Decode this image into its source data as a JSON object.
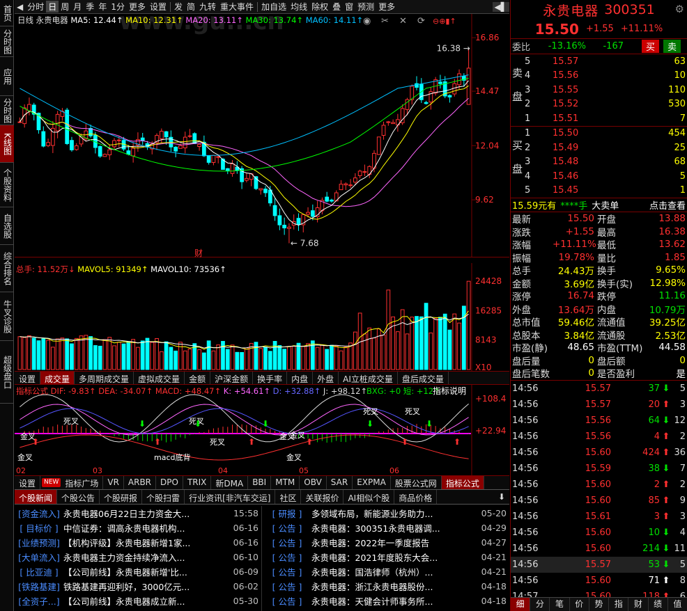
{
  "sidebar": [
    "首页",
    "分时图",
    "应用",
    "分时图",
    "K线图",
    "个股资料",
    "自选股",
    "综合排名",
    "牛叉诊股",
    "超级盘口"
  ],
  "toolbar": {
    "items": [
      "分时",
      "日",
      "周",
      "月",
      "季",
      "年",
      "1分",
      "更多",
      "设置",
      "发",
      "简",
      "九转",
      "重大事件",
      "加自选",
      "均线",
      "除权",
      "叠",
      "窗",
      "预测",
      "更多"
    ],
    "selected": "日"
  },
  "watermark": "www.gu...cn",
  "kline": {
    "period": "日线",
    "stock": "永贵电器",
    "ma": [
      {
        "label": "MA5: 12.44",
        "color": "#ffffff"
      },
      {
        "label": "MA10: 12.31",
        "color": "#ffff00"
      },
      {
        "label": "MA20: 13.11",
        "color": "#ff66ff"
      },
      {
        "label": "MA30: 13.74",
        "color": "#00ff00"
      },
      {
        "label": "MA60: 14.11",
        "color": "#00c0ff"
      }
    ],
    "price_ticks": [
      "16.86",
      "14.47",
      "12.04",
      "9.62"
    ],
    "high_label": "16.38",
    "low_label": "7.68",
    "event_label": "财"
  },
  "volume": {
    "title": "总手: 11.52万",
    "mavol5": "MAVOL5: 91349",
    "mavol10": "MAVOL10: 73536",
    "ticks": [
      "24428",
      "16285",
      "8143",
      "X10"
    ]
  },
  "volume_tabs": [
    "设置",
    "成交量",
    "多周期成交量",
    "虚拟成交量",
    "金额",
    "沪深金额",
    "换手率",
    "内盘",
    "外盘",
    "AI立桩成交量",
    "盘后成交量"
  ],
  "indicator": {
    "title": "指标公式",
    "dif": "DIF: -9.83",
    "dea": "DEA: -34.07",
    "macd": "MACD: +48.47",
    "k": "K: +54.61",
    "d": "D: +32.88",
    "j": "J: +98.12",
    "bxg": "BXG: +0",
    "short": "短: +12",
    "help": "指标说明",
    "ticks": [
      "+108.4",
      "+22.94"
    ],
    "months": [
      "02",
      "03",
      "04",
      "05",
      "06"
    ],
    "signals": [
      "金叉",
      "金叉",
      "macd底背",
      "死叉",
      "死叉",
      "死叉",
      "金叉",
      "死叉",
      "死叉",
      "金叉",
      "金叉"
    ]
  },
  "indicator_tabs": [
    "设置",
    "NEW",
    "指标广场",
    "VR",
    "ARBR",
    "DPO",
    "TRIX",
    "新DMA",
    "BBI",
    "MTM",
    "OBV",
    "SAR",
    "EXPMA",
    "股票公式网",
    "指标公式"
  ],
  "news_tabs": [
    "个股新闻",
    "个股公告",
    "个股研报",
    "个股扫雷",
    "行业资讯[非汽车交运]",
    "社区",
    "关联报价",
    "AI相似个股",
    "商品价格"
  ],
  "news_left": [
    {
      "tag": "[资金流入]",
      "text": "永贵电器06月22日主力资金大...",
      "date": "15:58"
    },
    {
      "tag": "[ 目标价 ]",
      "text": "中信证券：调高永贵电器机构...",
      "date": "06-16"
    },
    {
      "tag": "[业绩预测]",
      "text": "【机构评级】永贵电器新增1家...",
      "date": "06-16"
    },
    {
      "tag": "[大单流入]",
      "text": "永贵电器主力资金持续净流入...",
      "date": "06-10"
    },
    {
      "tag": "[ 比亚迪 ]",
      "text": "【公司前线】永贵电器新增'比...",
      "date": "06-09"
    },
    {
      "tag": "[铁路基建]",
      "text": "铁路基建再迎利好，3000亿元...",
      "date": "06-02"
    },
    {
      "tag": "[全资子...]",
      "text": "【公司前线】永贵电器成立新...",
      "date": "05-30"
    }
  ],
  "news_right": [
    {
      "tag": "[ 研报 ]",
      "text": "多领域布局，新能源业务助力...",
      "date": "05-20"
    },
    {
      "tag": "[ 公告 ]",
      "text": "永贵电器：300351永贵电器调...",
      "date": "04-29"
    },
    {
      "tag": "[ 公告 ]",
      "text": "永贵电器：2022年一季度报告",
      "date": "04-27"
    },
    {
      "tag": "[ 公告 ]",
      "text": "永贵电器：2021年度股东大会...",
      "date": "04-21"
    },
    {
      "tag": "[ 公告 ]",
      "text": "永贵电器：国浩律师（杭州）...",
      "date": "04-21"
    },
    {
      "tag": "[ 公告 ]",
      "text": "永贵电器：浙江永贵电器股份...",
      "date": "04-18"
    },
    {
      "tag": "[ 公告 ]",
      "text": "永贵电器：天健会计师事务所...",
      "date": "04-18"
    }
  ],
  "quote": {
    "name": "永贵电器",
    "code": "300351",
    "price": "15.50",
    "change": "+1.55",
    "pct": "+11.11%",
    "weibi_label": "委比",
    "weibi": "-13.16%",
    "weicha": "-167",
    "buy": "买",
    "sell": "卖",
    "asks": [
      {
        "lv": "5",
        "p": "15.57",
        "v": "63"
      },
      {
        "lv": "4",
        "p": "15.56",
        "v": "10"
      },
      {
        "lv": "3",
        "p": "15.55",
        "v": "110"
      },
      {
        "lv": "2",
        "p": "15.52",
        "v": "530"
      },
      {
        "lv": "1",
        "p": "15.51",
        "v": "7"
      }
    ],
    "bids": [
      {
        "lv": "1",
        "p": "15.50",
        "v": "454"
      },
      {
        "lv": "2",
        "p": "15.49",
        "v": "25"
      },
      {
        "lv": "3",
        "p": "15.48",
        "v": "68"
      },
      {
        "lv": "4",
        "p": "15.46",
        "v": "5"
      },
      {
        "lv": "5",
        "p": "15.45",
        "v": "1"
      }
    ],
    "ask_label": [
      "卖",
      "盘"
    ],
    "bid_label": [
      "买",
      "盘"
    ],
    "promo": {
      "a": "15.59元有",
      "b": "****手",
      "c": "大卖单",
      "d": "点击查看"
    },
    "stats": [
      [
        "最新",
        "15.50",
        "red",
        "开盘",
        "13.88",
        "red"
      ],
      [
        "涨跌",
        "+1.55",
        "red",
        "最高",
        "16.38",
        "red"
      ],
      [
        "涨幅",
        "+11.11%",
        "red",
        "最低",
        "13.62",
        "red"
      ],
      [
        "振幅",
        "19.78%",
        "red",
        "量比",
        "1.85",
        "red"
      ],
      [
        "总手",
        "24.43万",
        "yel",
        "换手",
        "9.65%",
        "yel"
      ],
      [
        "金额",
        "3.69亿",
        "yel",
        "换手(实)",
        "12.98%",
        "yel"
      ],
      [
        "涨停",
        "16.74",
        "red",
        "跌停",
        "11.16",
        "green"
      ],
      [
        "外盘",
        "13.64万",
        "red",
        "内盘",
        "10.79万",
        "green"
      ],
      [
        "总市值",
        "59.46亿",
        "yel",
        "流通值",
        "39.25亿",
        "yel"
      ],
      [
        "总股本",
        "3.84亿",
        "yel",
        "流通股",
        "2.53亿",
        "yel"
      ],
      [
        "市盈(静)",
        "48.65",
        "white",
        "市盈(TTM)",
        "44.58",
        "white"
      ],
      [
        "盘后量",
        "0",
        "yel",
        "盘后额",
        "0",
        "yel"
      ],
      [
        "盘后笔数",
        "0",
        "yel",
        "是否盈利",
        "是",
        "white"
      ]
    ],
    "ticks": [
      {
        "t": "14:56",
        "p": "15.57",
        "v": "37",
        "d": "down",
        "n": "5"
      },
      {
        "t": "14:56",
        "p": "15.57",
        "v": "20",
        "d": "up",
        "n": "3"
      },
      {
        "t": "14:56",
        "p": "15.56",
        "v": "64",
        "d": "down",
        "n": "12"
      },
      {
        "t": "14:56",
        "p": "15.56",
        "v": "4",
        "d": "up",
        "n": "2"
      },
      {
        "t": "14:56",
        "p": "15.60",
        "v": "424",
        "d": "up",
        "n": "36"
      },
      {
        "t": "14:56",
        "p": "15.59",
        "v": "38",
        "d": "down",
        "n": "7"
      },
      {
        "t": "14:56",
        "p": "15.60",
        "v": "2",
        "d": "up",
        "n": "2"
      },
      {
        "t": "14:56",
        "p": "15.60",
        "v": "85",
        "d": "up",
        "n": "9"
      },
      {
        "t": "14:56",
        "p": "15.61",
        "v": "3",
        "d": "up",
        "n": "3"
      },
      {
        "t": "14:56",
        "p": "15.60",
        "v": "10",
        "d": "down",
        "n": "4"
      },
      {
        "t": "14:56",
        "p": "15.60",
        "v": "214",
        "d": "down",
        "n": "11"
      },
      {
        "t": "14:56",
        "p": "15.57",
        "v": "53",
        "d": "down",
        "n": "5"
      },
      {
        "t": "14:56",
        "p": "15.60",
        "v": "71",
        "d": "neutral",
        "n": "8"
      },
      {
        "t": "14:57",
        "p": "15.60",
        "v": "118",
        "d": "up",
        "n": "6"
      }
    ],
    "bottom_tabs": [
      "细",
      "分",
      "笔",
      "价",
      "势",
      "指",
      "财",
      "绩",
      "值"
    ]
  },
  "colors": {
    "up": "#ff3030",
    "down": "#00ffff",
    "panel_border": "#700000",
    "accent": "#8a0000"
  }
}
